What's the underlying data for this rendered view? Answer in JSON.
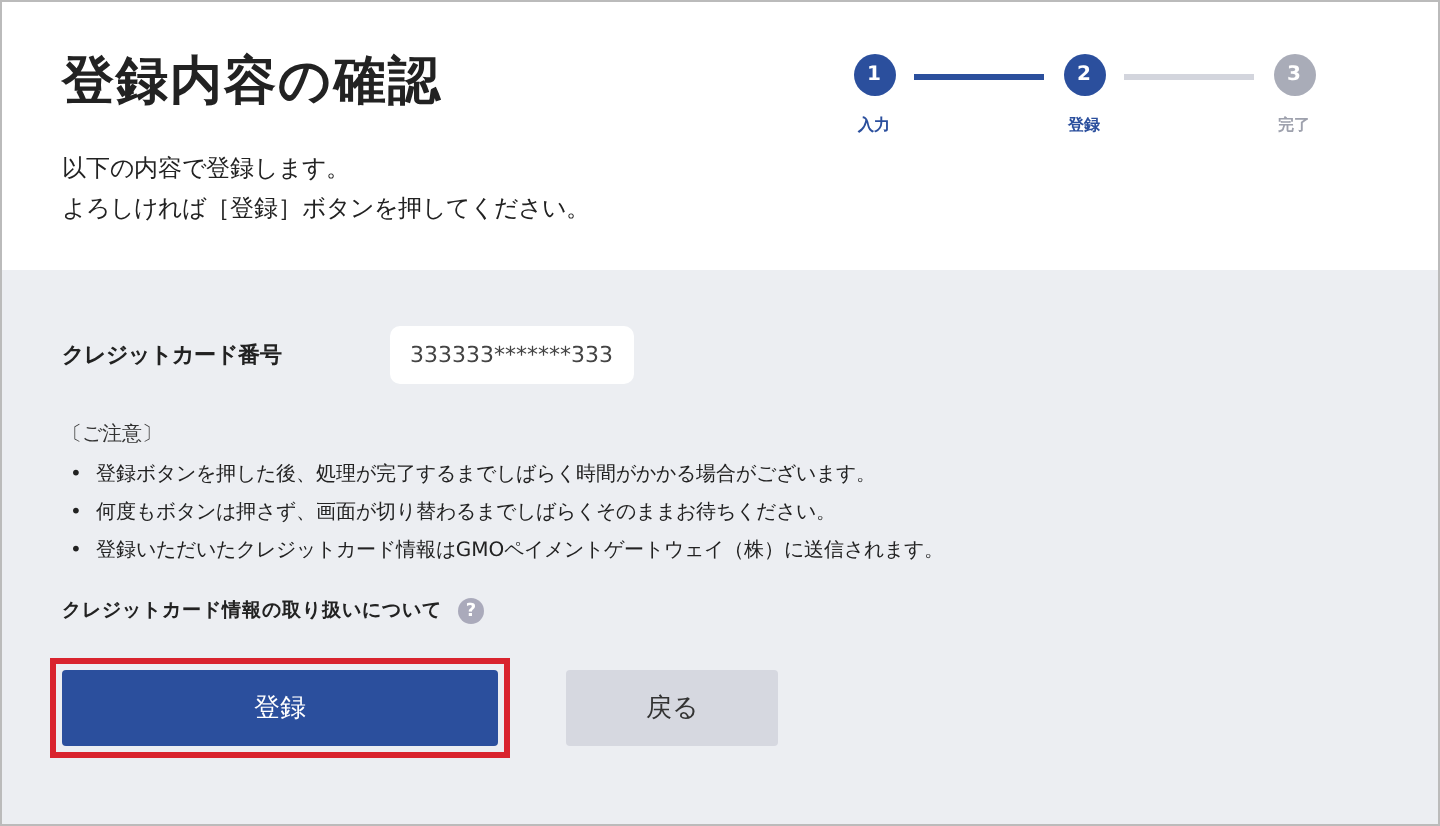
{
  "header": {
    "title": "登録内容の確認",
    "description": [
      "以下の内容で登録します。",
      "よろしければ［登録］ボタンを押してください。"
    ]
  },
  "steps": [
    {
      "number": "1",
      "label": "入力",
      "active": true
    },
    {
      "number": "2",
      "label": "登録",
      "active": true
    },
    {
      "number": "3",
      "label": "完了",
      "active": false
    }
  ],
  "card_field": {
    "label": "クレジットカード番号",
    "value": "333333*******333"
  },
  "notice": {
    "heading": "〔ご注意〕",
    "bullet": "•",
    "items": [
      "登録ボタンを押した後、処理が完了するまでしばらく時間がかかる場合がございます。",
      "何度もボタンは押さず、画面が切り替わるまでしばらくそのままお待ちください。",
      "登録いただいたクレジットカード情報はGMOペイメントゲートウェイ（株）に送信されます。"
    ]
  },
  "info_link": {
    "label": "クレジットカード情報の取り扱いについて",
    "help_icon": "?"
  },
  "buttons": [
    {
      "label": "登録",
      "kind": "primary",
      "highlighted": true
    },
    {
      "label": "戻る",
      "kind": "secondary",
      "highlighted": false
    }
  ]
}
